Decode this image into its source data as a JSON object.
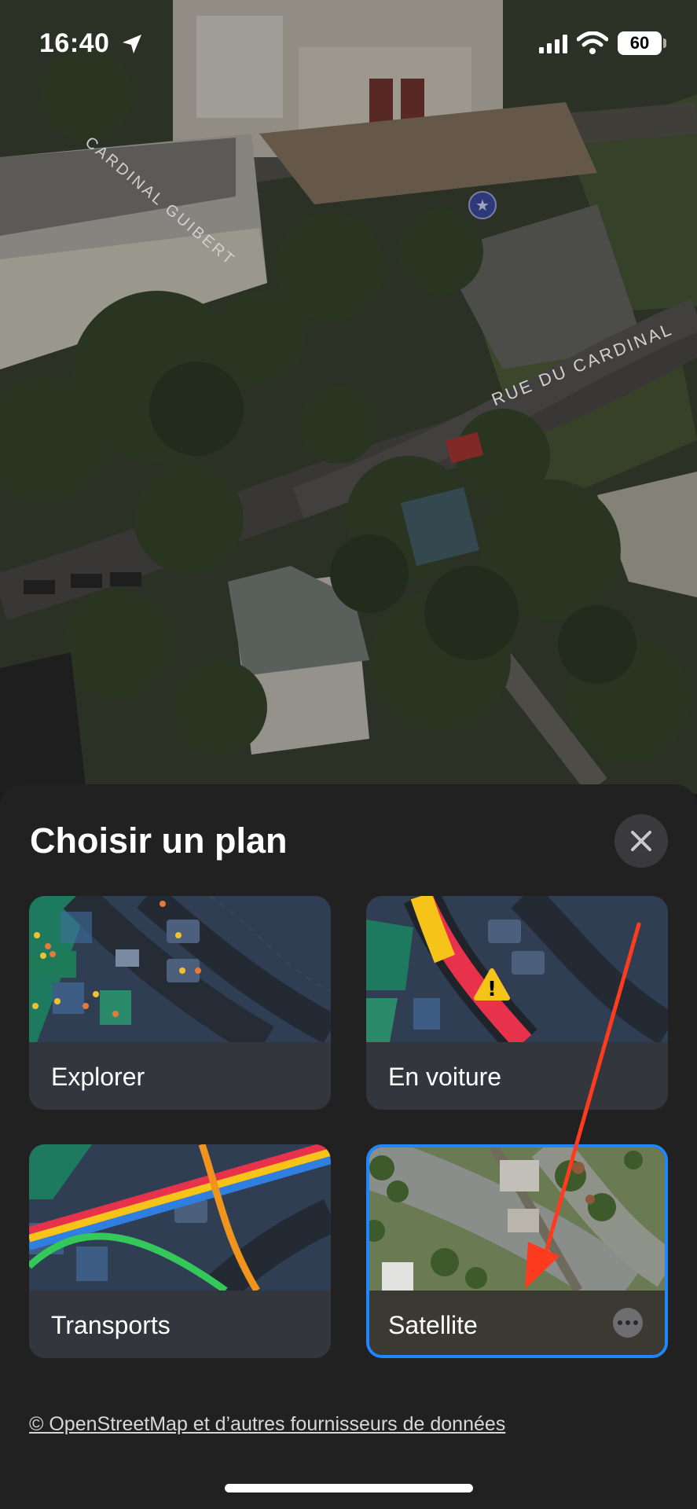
{
  "status_bar": {
    "time": "16:40",
    "battery": "60",
    "icons": [
      "location-arrow-icon",
      "cellular-signal-icon",
      "wifi-icon",
      "battery-icon"
    ]
  },
  "map": {
    "street_labels": [
      "CARDINAL GUIBERT",
      "RUE DU CARDINAL"
    ],
    "view": "satellite-3d"
  },
  "sheet": {
    "title": "Choisir un plan",
    "close_icon": "close-icon",
    "cards": [
      {
        "id": "explorer",
        "label": "Explorer",
        "selected": false
      },
      {
        "id": "voiture",
        "label": "En voiture",
        "selected": false
      },
      {
        "id": "transports",
        "label": "Transports",
        "selected": false
      },
      {
        "id": "satellite",
        "label": "Satellite",
        "selected": true
      }
    ],
    "attribution": "© OpenStreetMap et d’autres fournisseurs de données"
  },
  "colors": {
    "selected_border": "#1f87ff",
    "annotation_arrow": "#ff3b1f",
    "sheet_background": "#212122"
  }
}
